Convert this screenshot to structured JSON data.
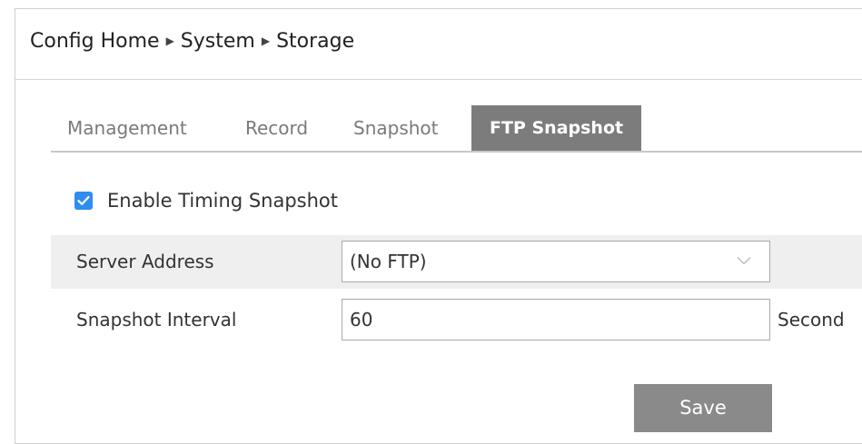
{
  "breadcrumb": {
    "items": [
      "Config Home",
      "System",
      "Storage"
    ],
    "separator": "▶"
  },
  "tabs": [
    {
      "label": "Management",
      "active": false
    },
    {
      "label": "Record",
      "active": false
    },
    {
      "label": "Snapshot",
      "active": false
    },
    {
      "label": "FTP Snapshot",
      "active": true
    }
  ],
  "enable_timing_snapshot": {
    "label": "Enable Timing Snapshot",
    "checked": true
  },
  "form": {
    "server_address": {
      "label": "Server Address",
      "selected": "(No FTP)"
    },
    "snapshot_interval": {
      "label": "Snapshot Interval",
      "value": "60",
      "unit": "Second"
    }
  },
  "save_label": "Save",
  "colors": {
    "active_tab": "#7c7c7c",
    "checkbox": "#2f8df0",
    "save_button": "#8a8a8a",
    "row_shade": "#efefef"
  }
}
